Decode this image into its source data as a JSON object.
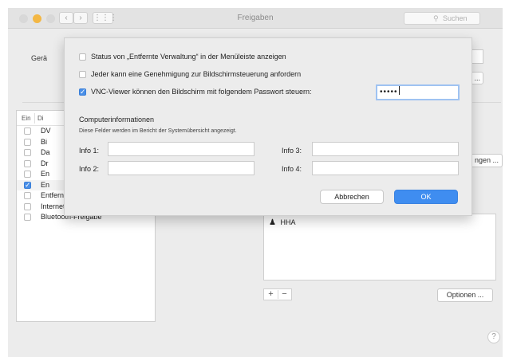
{
  "window": {
    "title": "Freigaben",
    "search_placeholder": "Suchen",
    "nav_back": "‹",
    "nav_forward": "›",
    "grid_icon": "⋮⋮⋮"
  },
  "background": {
    "label_partial": "Gerä",
    "list_header_ein": "Ein",
    "list_header_dienst": "Di",
    "services": [
      {
        "label": "DV",
        "checked": false
      },
      {
        "label": "Bi",
        "checked": false
      },
      {
        "label": "Da",
        "checked": false
      },
      {
        "label": "Dr",
        "checked": false
      },
      {
        "label": "En",
        "checked": false
      },
      {
        "label": "En",
        "checked": true
      },
      {
        "label": "Entfernte Apple-Events",
        "checked": false
      },
      {
        "label": "Internetfreigabe",
        "checked": false
      },
      {
        "label": "Bluetooth-Freigabe",
        "checked": false
      }
    ],
    "right_button": "ngen ...",
    "top_button": "...",
    "user": "HHA",
    "plus": "+",
    "minus": "−",
    "options_button": "Optionen ...",
    "help": "?"
  },
  "sheet": {
    "option1": "Status von „Entfernte Verwaltung“ in der Menüleiste anzeigen",
    "option2": "Jeder kann eine Genehmigung zur Bildschirmsteuerung anfordern",
    "option3": "VNC-Viewer können den Bildschirm mit folgendem Passwort steuern:",
    "password_mask": "•••••",
    "computer_info_title": "Computerinformationen",
    "computer_info_desc": "Diese Felder werden im Bericht der Systemübersicht angezeigt.",
    "info1": "Info 1:",
    "info2": "Info 2:",
    "info3": "Info 3:",
    "info4": "Info 4:",
    "cancel": "Abbrechen",
    "ok": "OK"
  },
  "colors": {
    "accent": "#3f8df0",
    "window_bg": "#ececec",
    "yellow_light": "#f3b744"
  }
}
